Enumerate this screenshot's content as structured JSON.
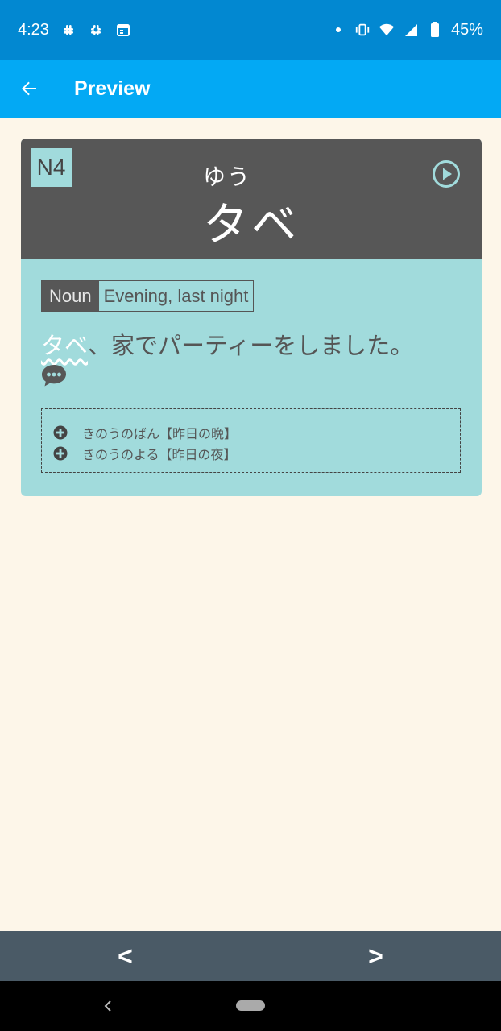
{
  "status_bar": {
    "time": "4:23",
    "left_icons": [
      "slack-icon",
      "slack-icon",
      "calendar-icon"
    ],
    "right_icons": [
      "dot-icon",
      "vibrate-icon",
      "wifi-icon",
      "signal-icon",
      "battery-icon"
    ],
    "battery": "45%"
  },
  "app_bar": {
    "title": "Preview"
  },
  "card": {
    "level": "N4",
    "reading": "ゆう",
    "word": "タベ",
    "part_of_speech": "Noun",
    "meaning": "Evening, last night",
    "example": {
      "highlight": "タベ",
      "rest": "、家でパーティーをしました。"
    },
    "related": [
      "きのうのばん【昨日の晩】",
      "きのうのよる【昨日の夜】"
    ]
  },
  "bottom_nav": {
    "prev_label": "<",
    "next_label": ">"
  },
  "colors": {
    "status_bar": "#0288d1",
    "app_bar": "#03a9f4",
    "card_header": "#575757",
    "card_body": "#a1dbdc",
    "background": "#fdf6e9",
    "bottom_nav": "#4a5a66"
  }
}
